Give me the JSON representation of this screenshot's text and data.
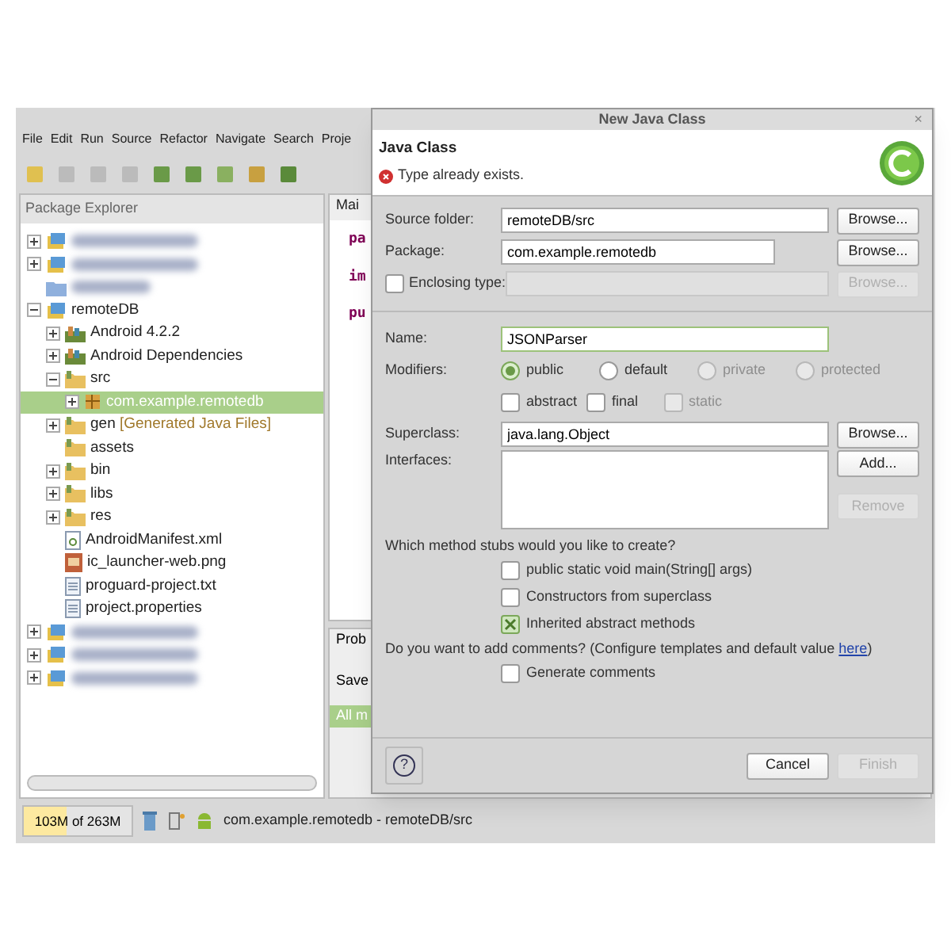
{
  "menu": [
    "File",
    "Edit",
    "Run",
    "Source",
    "Refactor",
    "Navigate",
    "Search",
    "Proje"
  ],
  "explorer": {
    "title": "Package Explorer",
    "tree": [
      {
        "kind": "blurred",
        "expanded": false,
        "selected": false
      },
      {
        "kind": "blurred",
        "expanded": false,
        "selected": false
      },
      {
        "kind": "blurred-folder",
        "selected": false
      },
      {
        "kind": "project",
        "label": "remoteDB",
        "expanded": true,
        "selected": false,
        "children": [
          {
            "kind": "library",
            "label": "Android 4.2.2",
            "expanded": false,
            "selected": false
          },
          {
            "kind": "library",
            "label": "Android Dependencies",
            "expanded": false,
            "selected": false
          },
          {
            "kind": "folder",
            "label": "src",
            "expanded": true,
            "selected": false,
            "children": [
              {
                "kind": "package",
                "label": "com.example.remotedb",
                "expanded": false,
                "selected": true
              }
            ]
          },
          {
            "kind": "folder",
            "label": "gen",
            "decoration": "[Generated Java Files]",
            "expanded": false,
            "selected": false
          },
          {
            "kind": "folder",
            "label": "assets",
            "selected": false
          },
          {
            "kind": "folder",
            "label": "bin",
            "expanded": false,
            "selected": false
          },
          {
            "kind": "folder",
            "label": "libs",
            "expanded": false,
            "selected": false
          },
          {
            "kind": "folder",
            "label": "res",
            "expanded": false,
            "selected": false
          },
          {
            "kind": "xml",
            "label": "AndroidManifest.xml",
            "selected": false
          },
          {
            "kind": "image",
            "label": "ic_launcher-web.png",
            "selected": false
          },
          {
            "kind": "file",
            "label": "proguard-project.txt",
            "selected": false
          },
          {
            "kind": "file",
            "label": "project.properties",
            "selected": false
          }
        ]
      },
      {
        "kind": "blurred",
        "expanded": false,
        "selected": false
      },
      {
        "kind": "blurred",
        "expanded": false,
        "selected": false
      },
      {
        "kind": "blurred",
        "expanded": false,
        "selected": false
      }
    ]
  },
  "editor": {
    "tab": "Mai",
    "lines": [
      "pa",
      "im",
      "pu"
    ]
  },
  "bottom_panel": {
    "tab": "Prob",
    "label": "Save",
    "row": "All m"
  },
  "status_bar": {
    "heap": "103M of 263M",
    "heap_level": {
      "level": 0.39
    },
    "text": "com.example.remotedb - remoteDB/src"
  },
  "dialog": {
    "title": "New Java Class",
    "close": "×",
    "heading": "Java Class",
    "error": "Type already exists.",
    "source_folder": {
      "label": "Source folder:",
      "value": "remoteDB/src",
      "button": "Browse...",
      "disabled": false
    },
    "package": {
      "label": "Package:",
      "value": "com.example.remotedb",
      "button": "Browse...",
      "disabled": false
    },
    "enclosing": {
      "label": "Enclosing type:",
      "checked": false,
      "button": "Browse...",
      "disabled": true
    },
    "name": {
      "label": "Name:",
      "value": "JSONParser"
    },
    "modifiers": {
      "label": "Modifiers:",
      "radios": [
        {
          "label": "public",
          "selected": true,
          "disabled": false
        },
        {
          "label": "default",
          "selected": false,
          "disabled": false
        },
        {
          "label": "private",
          "selected": false,
          "disabled": true
        },
        {
          "label": "protected",
          "selected": false,
          "disabled": true
        }
      ],
      "checks": [
        {
          "label": "abstract",
          "checked": false,
          "disabled": false
        },
        {
          "label": "final",
          "checked": false,
          "disabled": false
        },
        {
          "label": "static",
          "checked": false,
          "disabled": true
        }
      ]
    },
    "superclass": {
      "label": "Superclass:",
      "value": "java.lang.Object",
      "button": "Browse...",
      "disabled": false
    },
    "interfaces": {
      "label": "Interfaces:",
      "add": "Add...",
      "add_disabled": false,
      "remove": "Remove",
      "remove_disabled": true
    },
    "stubs_question": "Which method stubs would you like to create?",
    "stubs": [
      {
        "label": "public static void main(String[] args)",
        "checked": false
      },
      {
        "label": "Constructors from superclass",
        "checked": false
      },
      {
        "label": "Inherited abstract methods",
        "checked": true
      }
    ],
    "comments_question": "Do you want to add comments? (Configure templates and default value ",
    "comments_link": "here",
    "comments_end": ")",
    "generate": {
      "label": "Generate comments",
      "checked": false
    },
    "help": "?",
    "buttons": [
      {
        "label": "Cancel",
        "disabled": false
      },
      {
        "label": "Finish",
        "disabled": true
      }
    ]
  }
}
